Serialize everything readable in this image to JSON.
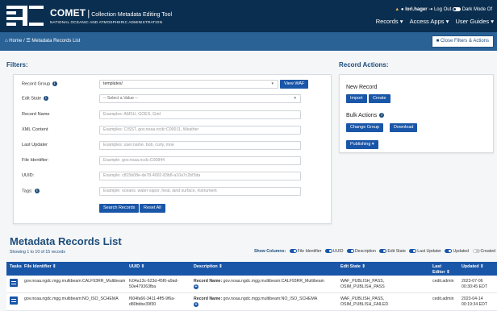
{
  "header": {
    "brand": "COMET",
    "tool_name": "Collection Metadata Editing Tool",
    "agency": "NATIONAL OCEANIC AND ATMOSPHERIC ADMINISTRATION",
    "user": "lori.hager",
    "logout": "Log Out",
    "dark_mode": "Dark Mode Of",
    "menus": [
      "Records ▾",
      "Access Apps ▾",
      "User Guides ▾"
    ]
  },
  "breadcrumb": {
    "home": "Home",
    "sep": "/",
    "current": "Metadata Records List",
    "close_filters": "Close Filters & Actions"
  },
  "filters": {
    "title": "Filters:",
    "record_group_label": "Record Group",
    "record_group_value": "templates/",
    "view_waf": "View WAF",
    "edit_state_label": "Edit State",
    "edit_state_value": "-- Select a Value --",
    "record_name_label": "Record Name",
    "record_name_ph": "Examples: AMSU, GOES, Grid",
    "xml_content_label": "XML Content",
    "xml_content_ph": "Examples: CISST, gov.noaa.ncdc:C00011, Weather",
    "last_updater_label": "Last Updater",
    "last_updater_ph": "Examples: user.name, bob, curly, moe",
    "file_identifier_label": "File Identifier:",
    "file_identifier_ph": "Example: gov.noaa.ncdc:C00844",
    "uuid_label": "UUID:",
    "uuid_ph": "Example: c815b08e-de78-4002-83b8-a10a7c2bf3da",
    "tags_label": "Tags:",
    "tags_ph": "Example: oceans, water vapor, heat, land surface, instrument",
    "search": "Search Records",
    "reset": "Reset All"
  },
  "actions": {
    "title": "Record Actions:",
    "new_record": "New Record",
    "import": "Import",
    "create": "Create",
    "bulk_actions": "Bulk Actions",
    "change_group": "Change Group",
    "download": "Download",
    "publishing": "Publishing ▾"
  },
  "list": {
    "title": "Metadata Records List",
    "showing": "Showing 1 to 10 of 15 records",
    "show_columns": "Show Columns:",
    "columns_toggles": [
      {
        "label": "File Identifier",
        "on": true
      },
      {
        "label": "UUID",
        "on": true
      },
      {
        "label": "Description",
        "on": true
      },
      {
        "label": "Edit State",
        "on": true
      },
      {
        "label": "Last Updater",
        "on": true
      },
      {
        "label": "Updated",
        "on": true
      },
      {
        "label": "Created",
        "on": false
      }
    ],
    "headers": {
      "tasks": "Tasks",
      "file_identifier": "File Identifier ⇕",
      "uuid": "UUID ⇕",
      "description": "Description ⇕",
      "edit_state": "Edit State ⇕",
      "last_editor": "Last Editor ⇕",
      "updated": "Updated ⇕"
    },
    "rows": [
      {
        "file_identifier": "gov.noaa.ngdc.mgg.multibeam:CALF93RR_Multibeam",
        "uuid1": "fc04a13c-623d-45f0-a9ad-",
        "uuid2": "50e479363fba",
        "desc_label": "Record Name:",
        "desc_value": "gov.noaa.ngdc.mgg.multibeam:CALF93RR_Multibeam",
        "state1": "WAF_PUBLISH_PASS,",
        "state2": "OSIM_PUBLISH_PASS",
        "editor": "cedit.admin",
        "updated1": "2023-07-06",
        "updated2": "00:30:45 EDT"
      },
      {
        "file_identifier": "gov.noaa.ngdc.mgg.multibeam:NO_ISO_SCHEMA",
        "uuid1": "f604fa66-3411-4ff5-9f6a-",
        "uuid2": "d80bbbe39f30",
        "desc_label": "Record Name:",
        "desc_value": "gov.noaa.ngdc.mgg.multibeam:NO_ISO_SCHEMA",
        "state1": "WAF_PUBLISH_PASS,",
        "state2": "OSIM_PUBLISH_FAILED",
        "editor": "cedit.admin",
        "updated1": "2023-04-14",
        "updated2": "00:19:34 EDT"
      }
    ]
  }
}
